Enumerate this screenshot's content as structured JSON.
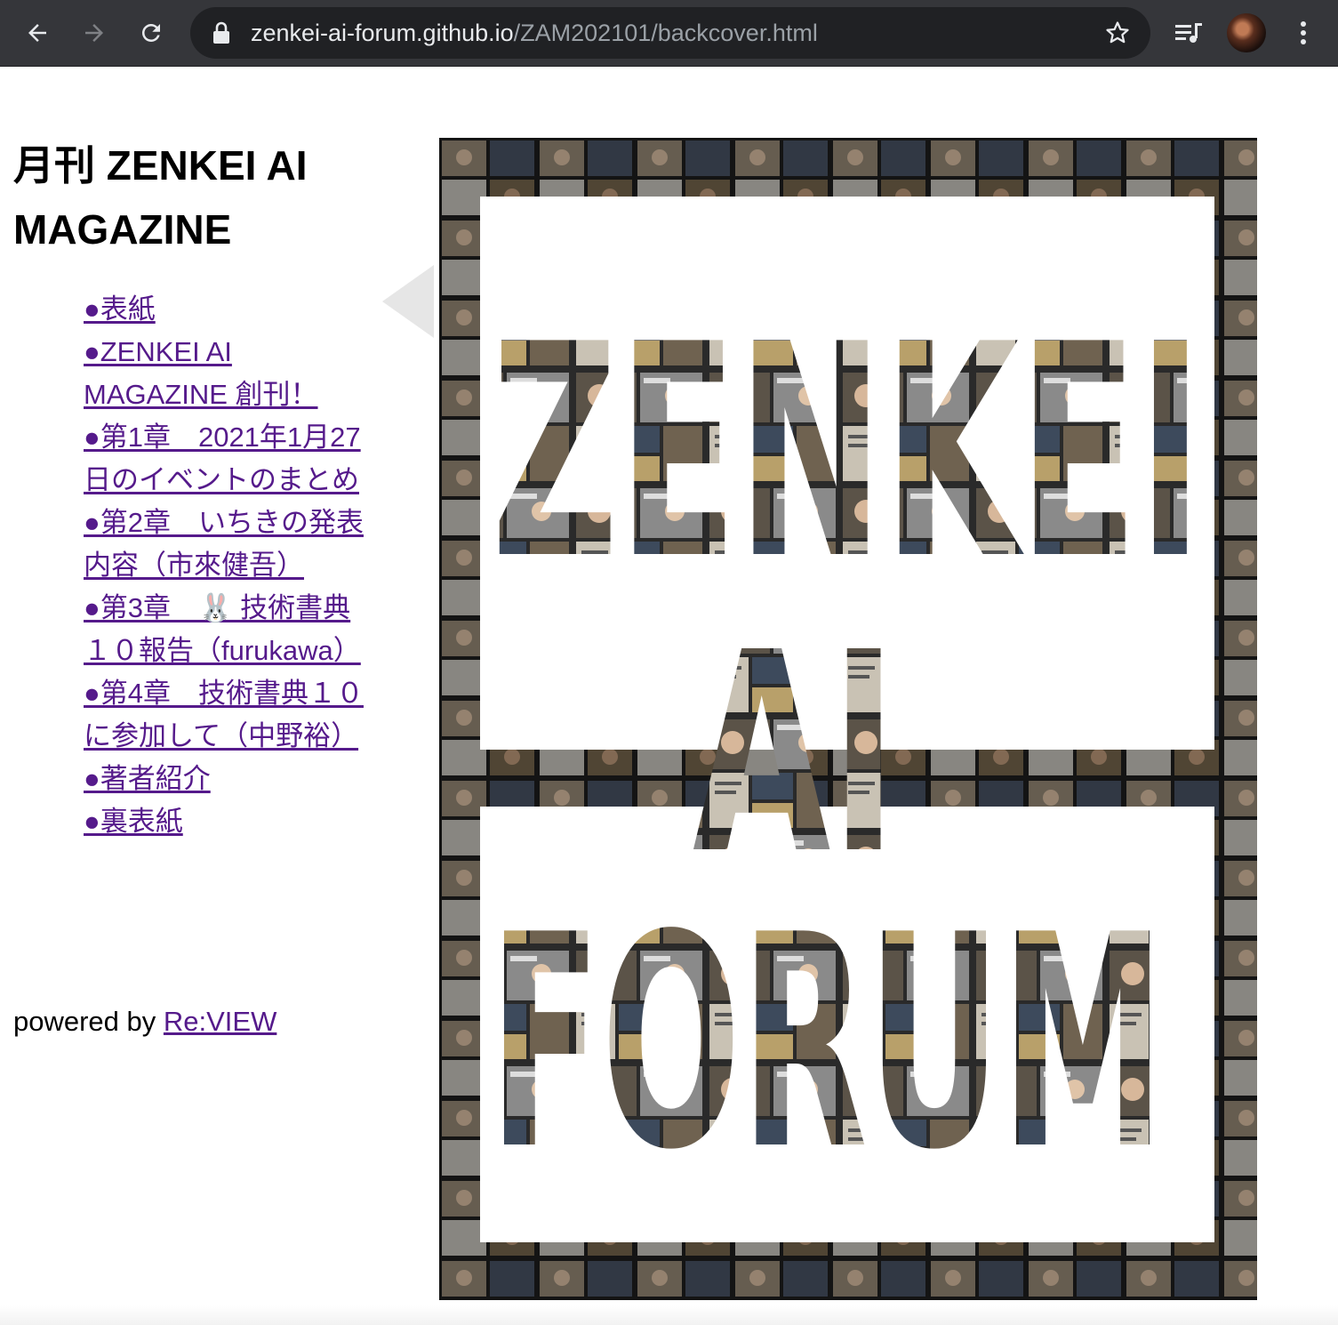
{
  "browser": {
    "url_host": "zenkei-ai-forum.github.io",
    "url_path": "/ZAM202101/backcover.html",
    "icons": [
      "back-arrow-icon",
      "forward-arrow-icon",
      "reload-icon",
      "lock-icon",
      "star-icon",
      "media-queue-icon",
      "profile-avatar",
      "menu-dots-icon"
    ]
  },
  "page": {
    "title": "月刊 ZENKEI AI MAGAZINE",
    "toc": [
      "●表紙",
      "●ZENKEI AI MAGAZINE 創刊！",
      "●第1章　2021年1月27日のイベントのまとめ",
      "●第2章　いちきの発表内容（市來健吾）",
      "●第3章　🐰 技術書典１０報告（furukawa）",
      "●第4章　技術書典１０に参加して（中野裕）",
      "●著者紹介",
      "●裏表紙"
    ],
    "powered_prefix": "powered by ",
    "powered_link": "Re:VIEW"
  },
  "cover": {
    "line1": "ZENKEI",
    "line2": "AI",
    "line3": "FORUM"
  },
  "colors": {
    "chrome_bg": "#35363a",
    "omnibox_bg": "#202124",
    "link_visited": "#551a8b"
  }
}
